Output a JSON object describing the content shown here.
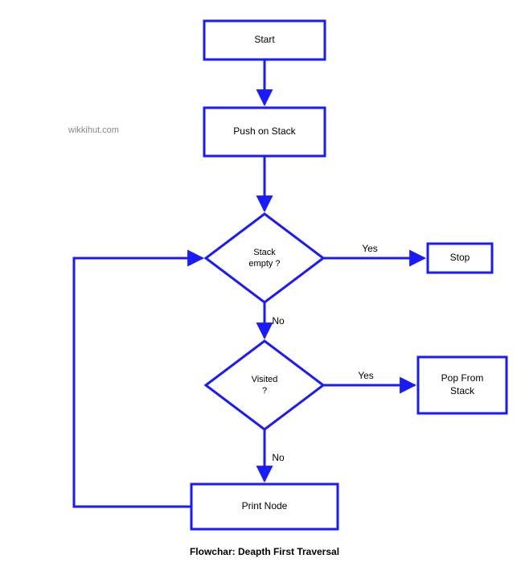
{
  "watermark": "wikkihut.com",
  "caption": "Flowchar: Deapth First Traversal",
  "nodes": {
    "start": {
      "line1": "Start"
    },
    "push": {
      "line1": "Push on Stack"
    },
    "d1": {
      "line1": "Stack",
      "line2": "empty ?"
    },
    "stop": {
      "line1": "Stop"
    },
    "d2": {
      "line1": "Visited",
      "line2": "?"
    },
    "pop": {
      "line1": "Pop From",
      "line2": "Stack"
    },
    "print": {
      "line1": "Print Node"
    }
  },
  "edge_labels": {
    "d1_yes": "Yes",
    "d1_no": "No",
    "d2_yes": "Yes",
    "d2_no": "No"
  },
  "colors": {
    "stroke": "#1a1aff"
  }
}
